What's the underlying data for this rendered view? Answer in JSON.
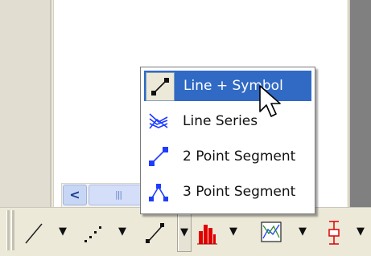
{
  "window": {
    "horizontal_scrollbar": {
      "left_arrow_glyph": "<",
      "thumb_grip_glyph": "|||"
    }
  },
  "toolbar": {
    "buttons": [
      {
        "name": "line-tool",
        "icon": "line-icon"
      },
      {
        "name": "dotted-line-tool",
        "icon": "dotted-line-icon"
      },
      {
        "name": "line-symbol-tool",
        "icon": "line-symbol-icon"
      },
      {
        "name": "bar-chart-tool",
        "icon": "bar-chart-icon",
        "color": "#e00000"
      },
      {
        "name": "line-series-tool",
        "icon": "line-series-icon"
      },
      {
        "name": "error-bar-tool",
        "icon": "error-bar-icon",
        "color": "#e00000"
      }
    ],
    "dropdown_glyph": "▼"
  },
  "menu": {
    "items": [
      {
        "label": "Line + Symbol",
        "icon": "line-symbol-icon",
        "selected": true
      },
      {
        "label": "Line Series",
        "icon": "line-series-icon",
        "selected": false
      },
      {
        "label": "2 Point Segment",
        "icon": "two-point-segment-icon",
        "selected": false
      },
      {
        "label": "3 Point Segment",
        "icon": "three-point-segment-icon",
        "selected": false
      }
    ]
  },
  "colors": {
    "selection": "#316ac5",
    "icon_blue": "#1e3cff",
    "icon_red": "#e00000",
    "face": "#ece9d8"
  }
}
